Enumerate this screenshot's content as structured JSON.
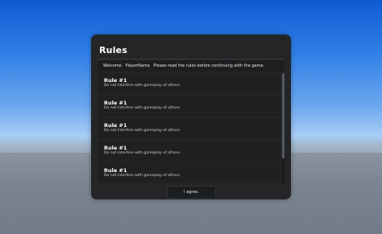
{
  "dialog": {
    "title": "Rules",
    "welcome": {
      "greeting": "Welcome",
      "player_name": "PlayerName",
      "message": "Please read the rules before continuing with the game."
    },
    "rules": [
      {
        "title": "Rule #1",
        "description": "Do not interfere with gameplay of others"
      },
      {
        "title": "Rule #1",
        "description": "Do not interfere with gameplay of others"
      },
      {
        "title": "Rule #1",
        "description": "Do not interfere with gameplay of others"
      },
      {
        "title": "Rule #1",
        "description": "Do not interfere with gameplay of others"
      },
      {
        "title": "Rule #1",
        "description": "Do not interfere with gameplay of others"
      }
    ],
    "agree_label": "I agree."
  }
}
